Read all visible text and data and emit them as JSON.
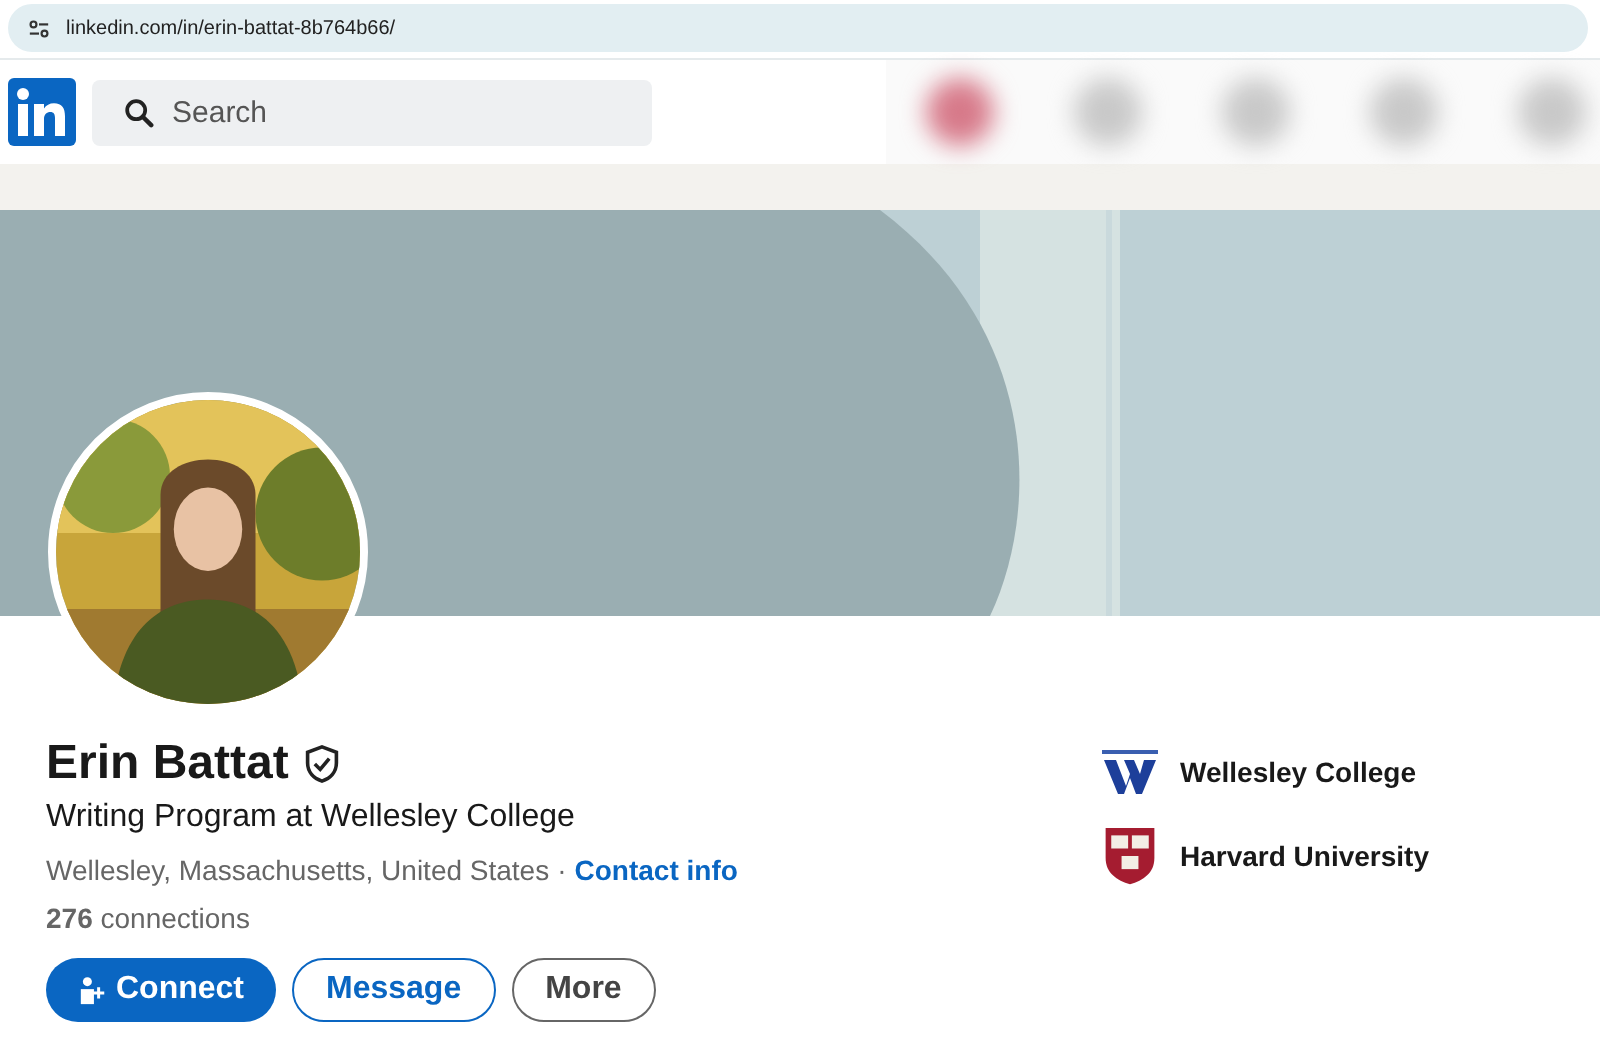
{
  "browser": {
    "url": "linkedin.com/in/erin-battat-8b764b66/"
  },
  "header": {
    "search": {
      "placeholder": "Search"
    }
  },
  "profile": {
    "name": "Erin Battat",
    "verified": true,
    "headline": "Writing Program at Wellesley College",
    "location": "Wellesley, Massachusetts, United States",
    "separator": "·",
    "contact_link": "Contact info",
    "connections": "**276** connections",
    "buttons": [
      {
        "label": "Connect",
        "kind": "primary"
      },
      {
        "label": "Message",
        "kind": "secondary"
      },
      {
        "label": "More",
        "kind": "neutral"
      }
    ],
    "education": [
      {
        "name": "Wellesley College",
        "kind": "wellesley"
      },
      {
        "name": "Harvard University",
        "kind": "harvard"
      }
    ]
  }
}
